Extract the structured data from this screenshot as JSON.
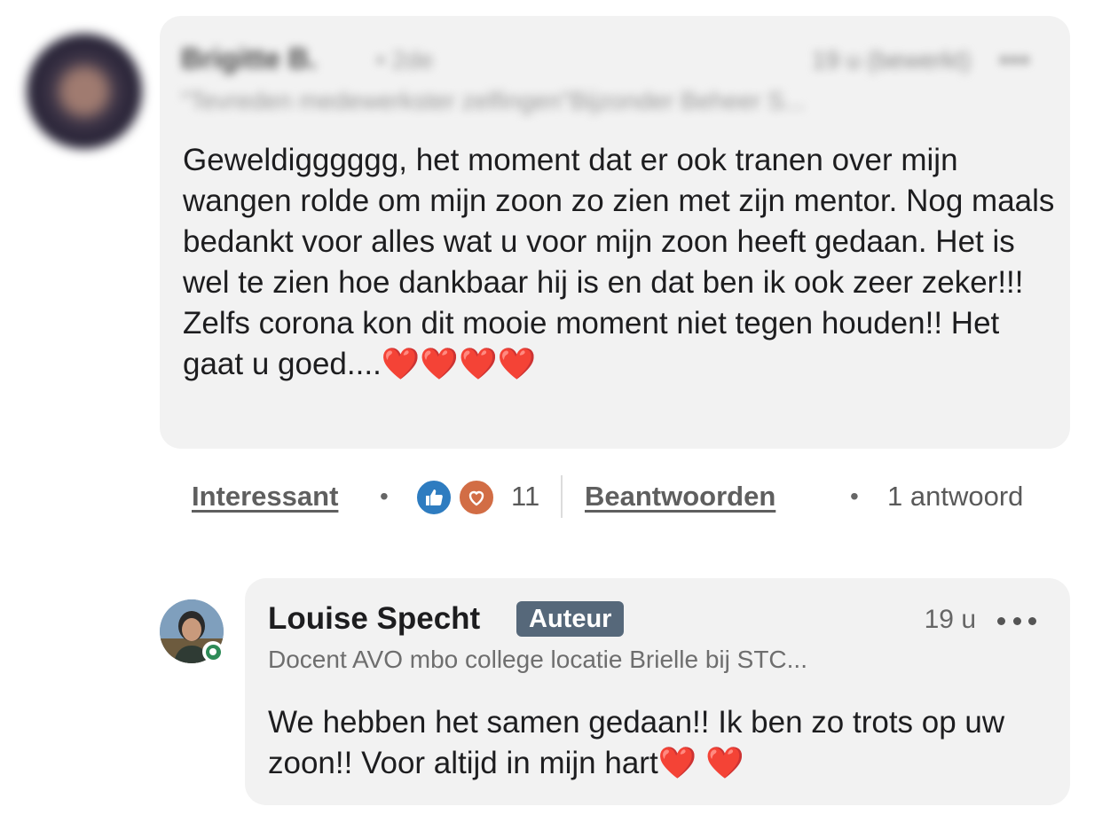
{
  "comment": {
    "author_name": "Brigitte B.",
    "degree": "• 2de",
    "timestamp": "19 u (bewerkt)",
    "more_label": "•••",
    "headline": "\"Tevreden medewerkster zelfingen\"Bijzonder Beheer S...",
    "text": "Geweldigggggg, het moment dat er ook tranen over mijn wangen rolde om mijn zoon zo zien met zijn mentor. Nog maals bedankt voor alles wat u voor mijn zoon heeft gedaan. Het is wel te zien hoe dankbaar hij is en dat ben ik ook zeer zeker!!! Zelfs corona kon dit mooie moment niet tegen houden!! Het gaat u goed....",
    "text_emoji": "❤️❤️❤️❤️"
  },
  "actions": {
    "react_label": "Interessant",
    "separator": "•",
    "reaction_count": "11",
    "reply_label": "Beantwoorden",
    "replies_label": "1 antwoord"
  },
  "reply": {
    "author_name": "Louise Specht",
    "badge": "Auteur",
    "timestamp": "19 u",
    "headline": "Docent AVO mbo college locatie Brielle bij STC...",
    "text": "We hebben het samen gedaan!! Ik ben zo trots op uw zoon!! Voor altijd in mijn hart",
    "text_emoji": "❤️ ❤️"
  },
  "colors": {
    "bubble": "#f2f2f2",
    "like": "#2e7cc0",
    "love": "#d26d45",
    "badge": "#56687a",
    "online": "#2e8b57"
  },
  "icons": [
    "like-reaction-icon",
    "love-reaction-icon",
    "more-icon",
    "online-status-icon"
  ]
}
